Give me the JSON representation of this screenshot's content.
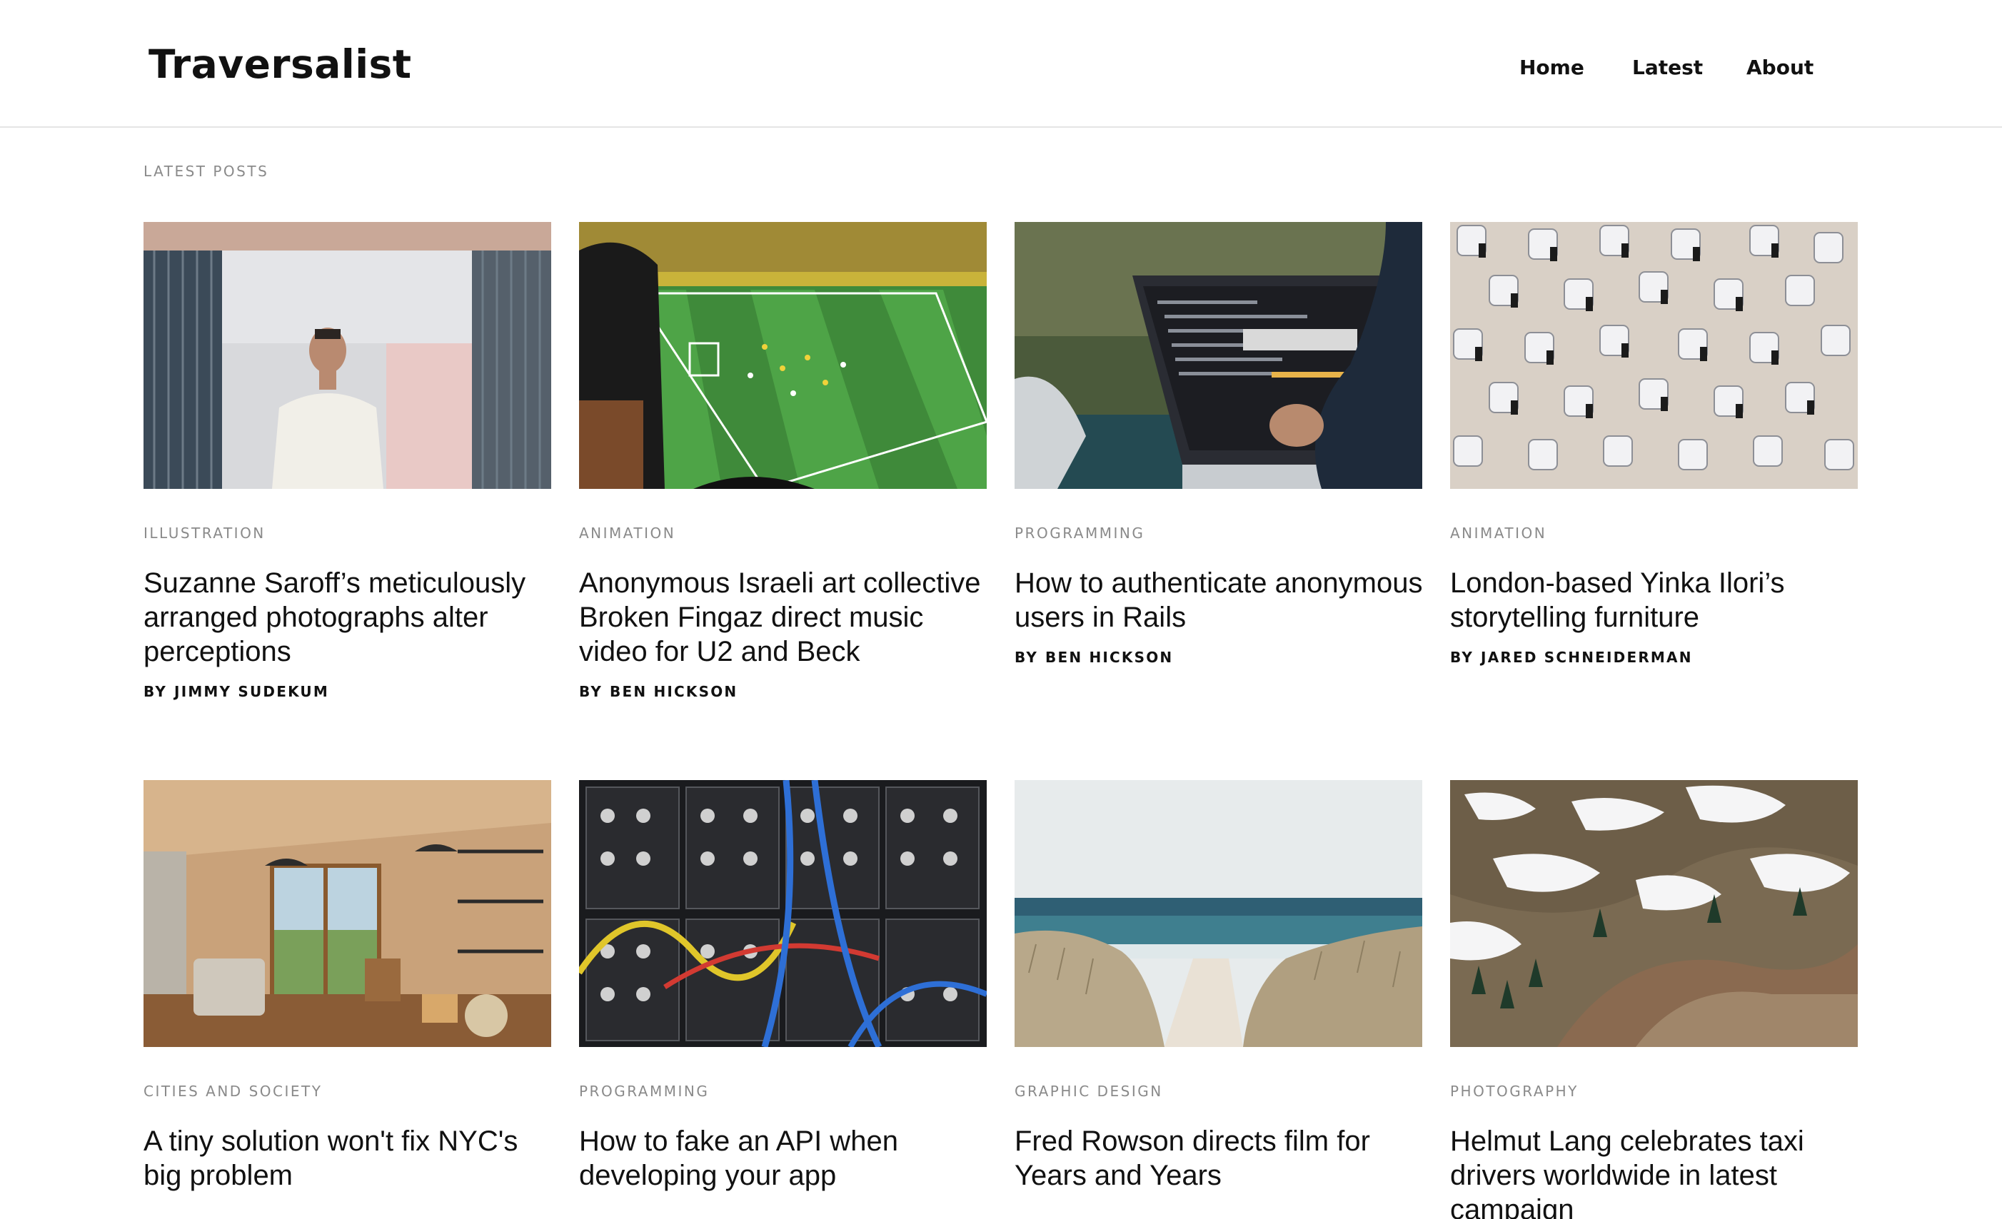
{
  "site": {
    "title": "Traversalist"
  },
  "nav": [
    {
      "label": "Home"
    },
    {
      "label": "Latest"
    },
    {
      "label": "About"
    }
  ],
  "section": {
    "label": "LATEST POSTS"
  },
  "byline_prefix": "BY",
  "posts": [
    {
      "category": "ILLUSTRATION",
      "title": "Suzanne Saroff’s meticulously arranged photographs alter perceptions",
      "author": "JIMMY SUDEKUM",
      "image": "man-in-shipping-container"
    },
    {
      "category": "ANIMATION",
      "title": "Anonymous Israeli art collective Broken Fingaz direct music video for U2 and Beck",
      "author": "BEN HICKSON",
      "image": "football-stadium"
    },
    {
      "category": "PROGRAMMING",
      "title": "How to authenticate anonymous users in Rails",
      "author": "BEN HICKSON",
      "image": "laptop-code"
    },
    {
      "category": "ANIMATION",
      "title": "London-based Yinka Ilori’s storytelling furniture",
      "author": "JARED SCHNEIDERMAN",
      "image": "beach-chairs"
    },
    {
      "category": "CITIES AND SOCIETY",
      "title": "A tiny solution won't fix NYC's big problem",
      "author": "",
      "image": "tiny-house-interior"
    },
    {
      "category": "PROGRAMMING",
      "title": "How to fake an API when developing your app",
      "author": "",
      "image": "modular-synth"
    },
    {
      "category": "GRAPHIC DESIGN",
      "title": "Fred Rowson directs film for Years and Years",
      "author": "",
      "image": "beach-dunes"
    },
    {
      "category": "PHOTOGRAPHY",
      "title": "Helmut Lang celebrates taxi drivers worldwide in latest campaign",
      "author": "",
      "image": "snowy-mountains"
    }
  ]
}
